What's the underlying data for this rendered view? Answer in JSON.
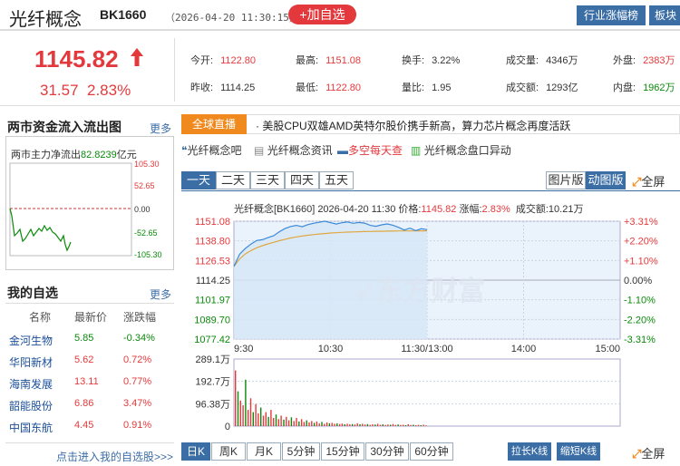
{
  "header": {
    "title": "光纤概念",
    "code": "BK1660",
    "datetime": "（2026-04-20 11:30:15）",
    "add_button": "+加自选",
    "industry_button": "行业涨幅榜",
    "sector_button": "板块"
  },
  "quote": {
    "price": "1145.82",
    "change": "31.57",
    "change_pct": "2.83%",
    "fields": [
      {
        "label": "今开:",
        "value": "1122.80",
        "color": "#e4393c"
      },
      {
        "label": "最高:",
        "value": "1151.08",
        "color": "#e4393c"
      },
      {
        "label": "换手:",
        "value": "3.22%",
        "color": "#333333"
      },
      {
        "label": "成交量:",
        "value": "4346万",
        "color": "#333333"
      },
      {
        "label": "外盘:",
        "value": "2383万",
        "color": "#e4393c"
      },
      {
        "label": "昨收:",
        "value": "1114.25",
        "color": "#333333"
      },
      {
        "label": "最低:",
        "value": "1122.80",
        "color": "#e4393c"
      },
      {
        "label": "量比:",
        "value": "1.95",
        "color": "#333333"
      },
      {
        "label": "成交额:",
        "value": "1293亿",
        "color": "#333333"
      },
      {
        "label": "内盘:",
        "value": "1962万",
        "color": "#0a8a0a"
      }
    ]
  },
  "flow_panel": {
    "title": "两市资金流入流出图",
    "more": "更多",
    "label": "两市主力净流出",
    "value": "82.8239",
    "unit": "亿元",
    "axis": [
      "105.30",
      "52.65",
      "0.00",
      "-52.65",
      "-105.30"
    ]
  },
  "watchlist": {
    "title": "我的自选",
    "more": "更多",
    "headers": [
      "名称",
      "最新价",
      "涨跌幅"
    ],
    "rows": [
      {
        "name": "金河生物",
        "price": "5.85",
        "pct": "-0.34%",
        "color": "#0a8a0a"
      },
      {
        "name": "华阳新材",
        "price": "5.62",
        "pct": "0.72%",
        "color": "#e4393c"
      },
      {
        "name": "海南发展",
        "price": "13.11",
        "pct": "0.77%",
        "color": "#e4393c"
      },
      {
        "name": "韶能股份",
        "price": "6.86",
        "pct": "3.47%",
        "color": "#e4393c"
      },
      {
        "name": "中国东航",
        "price": "4.45",
        "pct": "0.91%",
        "color": "#e4393c"
      }
    ],
    "footer_link": "点击进入我的自选股>>>"
  },
  "news": {
    "badge": "全球直播",
    "headline": "· 美股CPU双雄AMD英特尔股价携手新高，算力芯片概念再度活跃"
  },
  "links": [
    "光纤概念吧",
    "光纤概念资讯",
    "多空每天查",
    "光纤概念盘口异动"
  ],
  "period_tabs": [
    "一天",
    "二天",
    "三天",
    "四天",
    "五天"
  ],
  "chart_toggle": {
    "image": "图片版",
    "dynamic": "动图版",
    "fullscreen": "全屏"
  },
  "kline_tabs": [
    "日K",
    "周K",
    "月K",
    "5分钟",
    "15分钟",
    "30分钟",
    "60分钟"
  ],
  "kline_buttons": {
    "long": "拉长K线",
    "short": "缩短K线",
    "fullscreen": "全屏"
  },
  "watermark": "东方财富",
  "chart_data": {
    "type": "line",
    "title": "光纤概念[BK1660]  2026-04-20 11:30  价格:",
    "price_value": "1145.82",
    "pct_label": "涨幅:",
    "pct_value": "2.83%",
    "volume_label": "成交额:10.21万",
    "y_left_ticks": [
      "1151.08",
      "1138.80",
      "1126.53",
      "1114.25",
      "1101.97",
      "1089.70",
      "1077.42"
    ],
    "y_right_ticks": [
      "+3.31%",
      "+2.20%",
      "+1.10%",
      "0.00%",
      "-1.10%",
      "-2.20%",
      "-3.31%"
    ],
    "x_ticks": [
      "9:30",
      "10:30",
      "11:30/13:00",
      "14:00",
      "15:00"
    ],
    "ylim": [
      1077.42,
      1151.08
    ],
    "prev_close": 1114.25,
    "price_series": [
      1122.8,
      1130.5,
      1134.0,
      1136.8,
      1139.0,
      1139.5,
      1140.8,
      1142.0,
      1144.5,
      1146.5,
      1147.8,
      1148.5,
      1147.6,
      1148.9,
      1149.8,
      1150.4,
      1151.08,
      1150.2,
      1149.3,
      1150.1,
      1150.6,
      1149.8,
      1150.3,
      1149.9,
      1148.5,
      1147.9,
      1148.8,
      1149.4,
      1148.6,
      1147.2,
      1145.6,
      1146.8,
      1145.2,
      1146.4,
      1145.82
    ],
    "avg_series": [
      1122.8,
      1127.5,
      1130.6,
      1132.7,
      1134.5,
      1135.8,
      1136.9,
      1137.9,
      1138.9,
      1139.8,
      1140.6,
      1141.3,
      1141.8,
      1142.3,
      1142.7,
      1143.1,
      1143.4,
      1143.7,
      1143.9,
      1144.1,
      1144.3,
      1144.4,
      1144.5,
      1144.6,
      1144.7,
      1144.8,
      1144.8,
      1144.9,
      1144.9,
      1145.0,
      1145.0,
      1145.0,
      1145.1,
      1145.1,
      1145.1
    ],
    "volume_ticks": [
      "289.1万",
      "192.7万",
      "96.38万",
      "0"
    ],
    "volume_max": 289.1,
    "volume_series": [
      240,
      150,
      110,
      90,
      200,
      70,
      120,
      60,
      95,
      55,
      80,
      45,
      60,
      40,
      70,
      35,
      50,
      30,
      45,
      28,
      40,
      25,
      38,
      22,
      35,
      20,
      30,
      18,
      25,
      16,
      22,
      14,
      20,
      12,
      18,
      10,
      16,
      12,
      14,
      10,
      12,
      9,
      11,
      8,
      10,
      8,
      9,
      7,
      12,
      8,
      10,
      7,
      9,
      6,
      8,
      7,
      10,
      6,
      8,
      5,
      7,
      6,
      9,
      5,
      7,
      5,
      6,
      4,
      8,
      5,
      6,
      4,
      5,
      4,
      6,
      3
    ]
  }
}
